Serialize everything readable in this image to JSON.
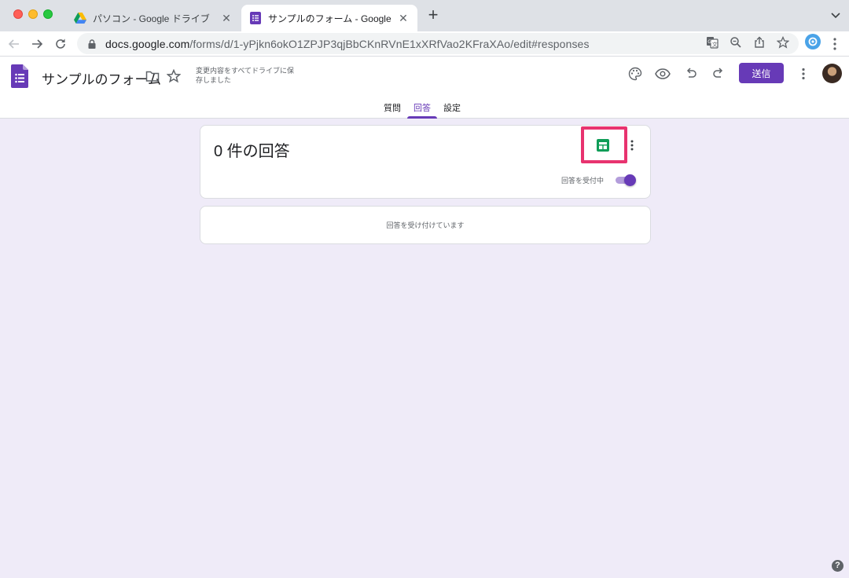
{
  "browser": {
    "tabs": [
      {
        "title": "パソコン - Google ドライブ",
        "favicon": "google-drive-icon",
        "active": false
      },
      {
        "title": "サンプルのフォーム - Google フォ",
        "favicon": "google-forms-icon",
        "active": true
      }
    ],
    "new_tab_label": "+",
    "url_host": "docs.google.com",
    "url_path": "/forms/d/1-yPjkn6okO1ZPJP3qjBbCKnRVnE1xXRfVao2KFraXAo/edit#responses"
  },
  "form": {
    "title": "サンプルのフォーム",
    "save_status": "変更内容をすべてドライブに保存しました",
    "send_label": "送信",
    "tabs": [
      {
        "label": "質問",
        "active": false
      },
      {
        "label": "回答",
        "active": true
      },
      {
        "label": "設定",
        "active": false
      }
    ]
  },
  "responses": {
    "count_title": "0 件の回答",
    "accepting_label": "回答を受付中",
    "accepting": true,
    "empty_message": "回答を受け付けています"
  },
  "help_label": "?",
  "colors": {
    "accent": "#673ab7",
    "background": "#efebf8",
    "highlight": "#e8336f",
    "sheets_green": "#0f9d58"
  }
}
